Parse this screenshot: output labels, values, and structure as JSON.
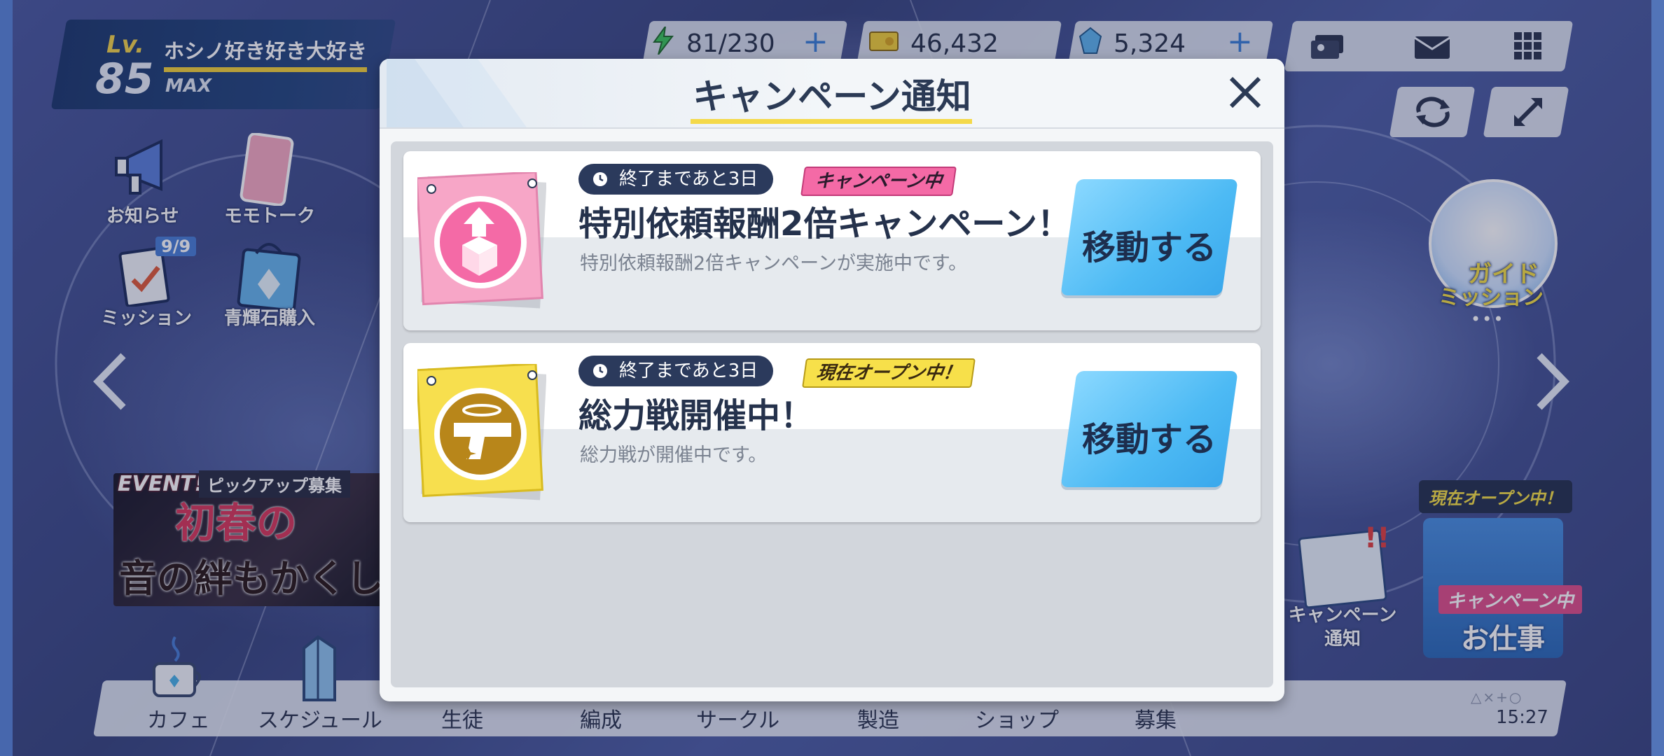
{
  "player": {
    "level_label": "Lv.",
    "level": "85",
    "name": "ホシノ好き好き大好き",
    "exp_status": "MAX"
  },
  "resources": {
    "ap": "81/230",
    "credits": "46,432",
    "pyroxene": "5,324",
    "plus": "+"
  },
  "left_menu": {
    "notice": "お知らせ",
    "momotalk": "モモトーク",
    "mission": "ミッション",
    "mission_badge": "9/9",
    "pyroxene_shop": "青輝石購入"
  },
  "event_banner": {
    "event_tag": "EVENT!",
    "pickup_tag": "ピックアップ募集",
    "title_line1": "初春の",
    "title_line2": "音の絆もかくしこそ"
  },
  "right_side": {
    "guide_line1": "ガイド",
    "guide_line2": "ミッション",
    "guide_dots": "•••",
    "campaign_notice_line1": "キャンペーン",
    "campaign_notice_line2": "通知",
    "open_now_bubble": "現在オープン中！",
    "work_badge": "キャンペーン中",
    "work_label": "お仕事"
  },
  "bottom_nav": {
    "items": [
      "カフェ",
      "スケジュール",
      "生徒",
      "編成",
      "サークル",
      "製造",
      "ショップ",
      "募集"
    ],
    "time": "15:27",
    "shapes": "△×+○"
  },
  "modal": {
    "title": "キャンペーン通知",
    "cards": [
      {
        "time_left": "終了まであと3日",
        "status": "キャンペーン中",
        "title": "特別依頼報酬2倍キャンペーン！",
        "description": "特別依頼報酬2倍キャンペーンが実施中です。",
        "button": "移動する",
        "thumb_color": "#f4a3c6",
        "icon": "box-upgrade-icon"
      },
      {
        "time_left": "終了まであと3日",
        "status": "現在オープン中！",
        "title": "総力戦開催中！",
        "description": "総力戦が開催中です。",
        "button": "移動する",
        "thumb_color": "#f5dc4a",
        "icon": "halo-gun-icon"
      }
    ]
  },
  "colors": {
    "accent_blue": "#4dbaf4",
    "pill_navy": "#2b3a5c",
    "tag_pink": "#f46aa6",
    "tag_yellow": "#f7e04a",
    "underline_yellow": "#f4d94a"
  }
}
